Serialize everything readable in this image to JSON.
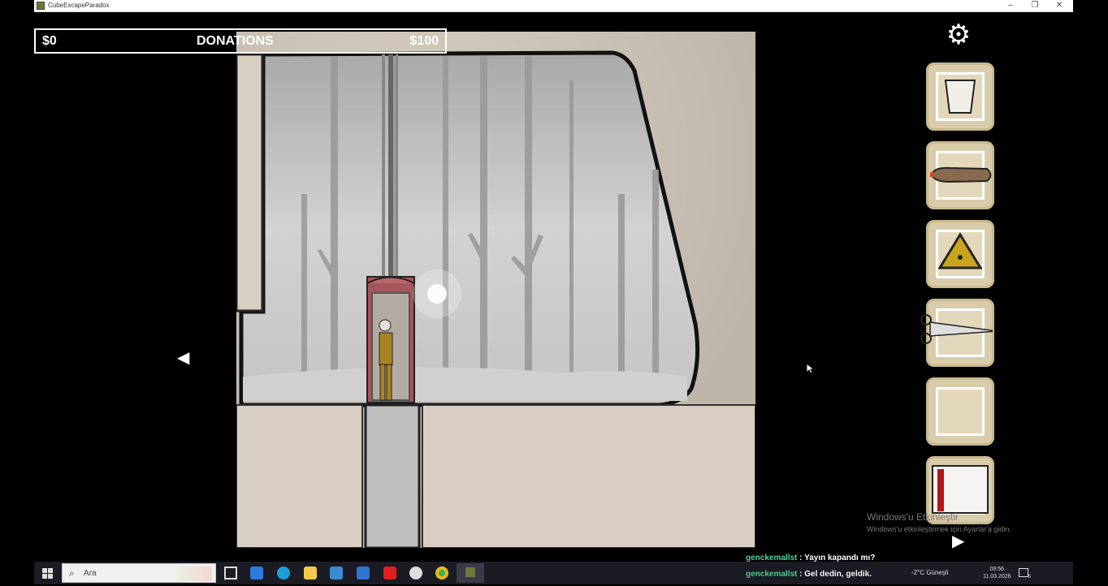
{
  "window": {
    "title": "CubeEscapeParadox",
    "minimize_icon": "minimize-icon",
    "maximize_icon": "restore-icon",
    "close_icon": "close-icon"
  },
  "hud": {
    "donations_label": "DONATIONS",
    "donations_current": "$0",
    "donations_goal": "$100",
    "settings_icon": "gear-icon"
  },
  "inventory": [
    {
      "item": "glass-icon"
    },
    {
      "item": "cigar-icon"
    },
    {
      "item": "yellow-triangle-icon"
    },
    {
      "item": "scissors-icon"
    },
    {
      "item": "empty"
    },
    {
      "item": "red-book-icon"
    }
  ],
  "navigation": {
    "left_arrow": "◀",
    "right_arrow": "▶"
  },
  "watermark": {
    "line1": "Windows'u Etkinleştir",
    "line2": "Windows'u etkinleştirmek için Ayarlar'a gidin."
  },
  "taskbar": {
    "search_placeholder": "Ara",
    "weather": "-2°C  Güneşli",
    "time": "09:56",
    "date": "11.03.2026",
    "notification_count": "5"
  },
  "chat": [
    {
      "user": "genckemallst",
      "message": " : Yayın kapandı mı?"
    },
    {
      "user": "genckemallst",
      "message": " : Gel dedin, geldik."
    }
  ],
  "colors": {
    "wall": "#d9d0c3",
    "inventory_slot": "#d9ccab",
    "chat_user": "#4fd39b",
    "taskbar": "#1b1b24"
  }
}
